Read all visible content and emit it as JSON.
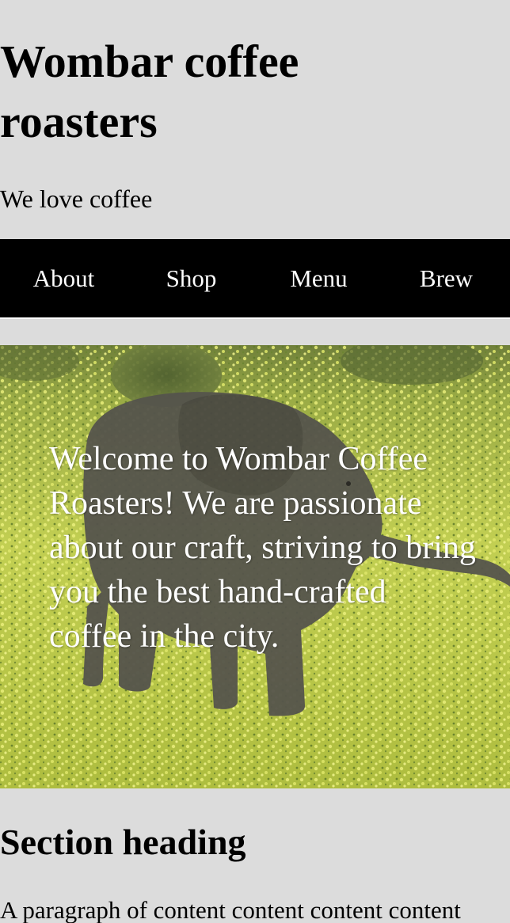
{
  "header": {
    "title": "Wombar coffee roasters",
    "tagline": "We love coffee"
  },
  "nav": {
    "items": [
      {
        "label": "About"
      },
      {
        "label": "Shop"
      },
      {
        "label": "Menu"
      },
      {
        "label": "Brew"
      }
    ]
  },
  "hero": {
    "image_subject": "baby elephant walking through a field of yellow flowers",
    "text": "Welcome to Wombar Coffee Roasters! We are passionate about our craft, striving to bring you the best hand-crafted coffee in the city."
  },
  "section": {
    "heading": "Section heading",
    "paragraph": "A paragraph of content content content content"
  },
  "colors": {
    "page_background": "#dcdcdc",
    "nav_background": "#000000",
    "nav_text": "#ffffff",
    "hero_text": "#ffffff"
  }
}
